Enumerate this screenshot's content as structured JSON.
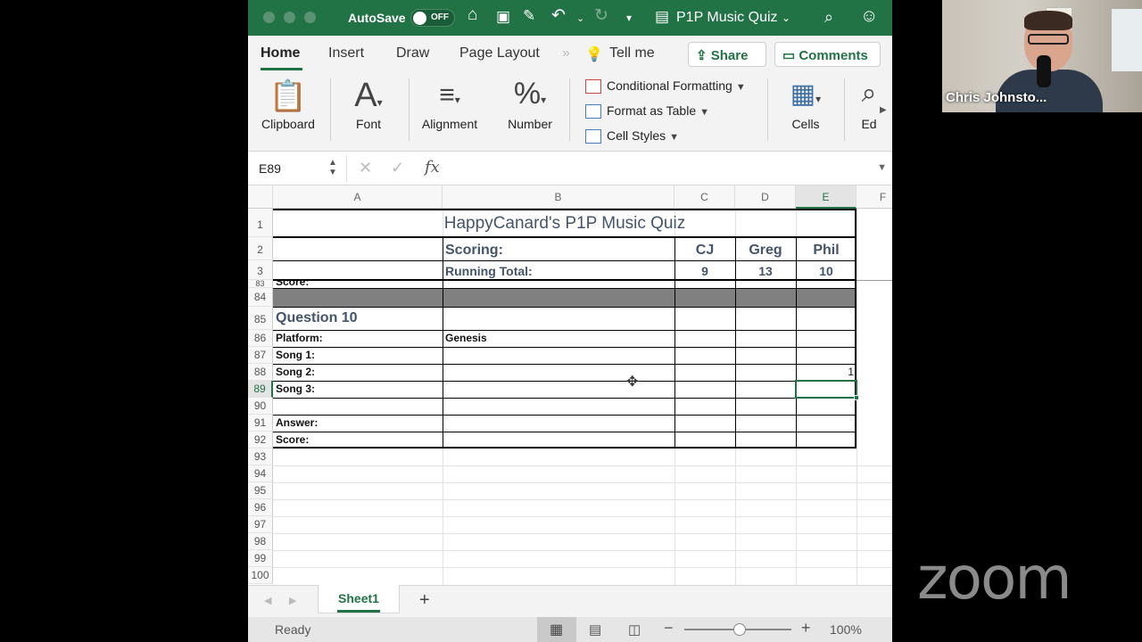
{
  "excel": {
    "autosave_label": "AutoSave",
    "autosave_state": "OFF",
    "doc_title": "P1P Music Quiz",
    "ribbon_tabs": [
      "Home",
      "Insert",
      "Draw",
      "Page Layout",
      "Tell me"
    ],
    "share_label": "Share",
    "comments_label": "Comments",
    "groups": {
      "clipboard": "Clipboard",
      "font": "Font",
      "alignment": "Alignment",
      "number": "Number",
      "cells": "Cells",
      "editing": "Ed"
    },
    "styles": [
      "Conditional Formatting",
      "Format as Table",
      "Cell Styles"
    ],
    "namebox": "E89",
    "formula": "",
    "columns": [
      "A",
      "B",
      "C",
      "D",
      "E",
      "F"
    ],
    "title": "HappyCanard's P1P Music Quiz",
    "scoring_label": "Scoring:",
    "running_total_label": "Running Total:",
    "players": [
      "CJ",
      "Greg",
      "Phil"
    ],
    "running_totals": [
      "9",
      "13",
      "10"
    ],
    "partial_label": "Score:",
    "rows": [
      {
        "num": "1"
      },
      {
        "num": "2"
      },
      {
        "num": "3"
      },
      {
        "num": "84"
      },
      {
        "num": "85",
        "a": "Question 10"
      },
      {
        "num": "86",
        "a": "Platform:",
        "b": "Genesis"
      },
      {
        "num": "87",
        "a": "Song 1:"
      },
      {
        "num": "88",
        "a": "Song 2:",
        "e": "1"
      },
      {
        "num": "89",
        "a": "Song 3:"
      },
      {
        "num": "90"
      },
      {
        "num": "91",
        "a": "Answer:"
      },
      {
        "num": "92",
        "a": "Score:"
      },
      {
        "num": "93"
      },
      {
        "num": "94"
      },
      {
        "num": "95"
      },
      {
        "num": "96"
      },
      {
        "num": "97"
      },
      {
        "num": "98"
      },
      {
        "num": "99"
      },
      {
        "num": "100"
      }
    ],
    "sheet_tab": "Sheet1",
    "add_sheet": "+",
    "status": "Ready",
    "zoom_level": 1.0,
    "zoom_text": "100%"
  },
  "webcam": {
    "name": "Chris Johnsto..."
  },
  "zoom_logo": "zoom",
  "colors": {
    "excel_green": "#217346",
    "header_gray": "#808080",
    "heading_blue": "#44546a"
  }
}
